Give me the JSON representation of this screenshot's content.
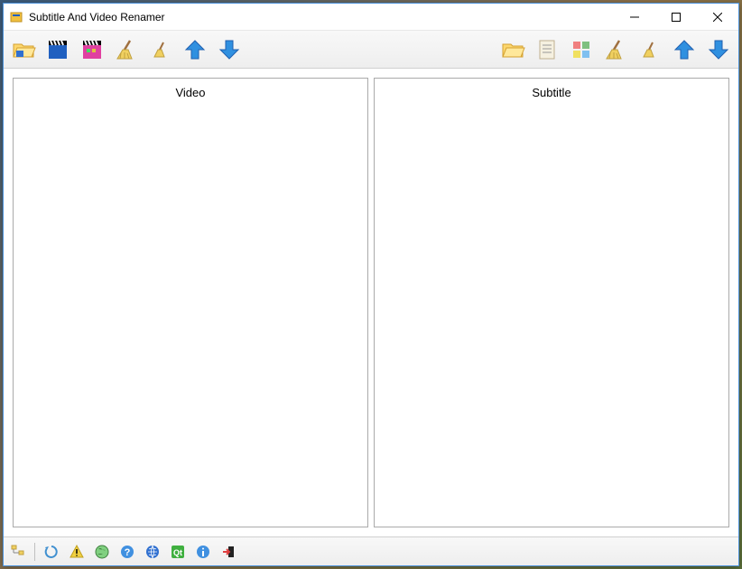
{
  "window": {
    "title": "Subtitle And Video Renamer"
  },
  "toolbar_left": {
    "icons": [
      "folder-open",
      "video-clapper",
      "video-color",
      "broom",
      "broom-small",
      "arrow-up",
      "arrow-down"
    ]
  },
  "toolbar_right": {
    "icons": [
      "folder-open",
      "document",
      "color-grid",
      "broom",
      "broom-small",
      "arrow-up",
      "arrow-down"
    ]
  },
  "panels": {
    "video": {
      "title": "Video"
    },
    "subtitle": {
      "title": "Subtitle"
    }
  },
  "statusbar": {
    "icons": [
      "tree",
      "refresh",
      "warning",
      "globe",
      "help",
      "globe-blue",
      "qt",
      "info",
      "exit"
    ]
  }
}
